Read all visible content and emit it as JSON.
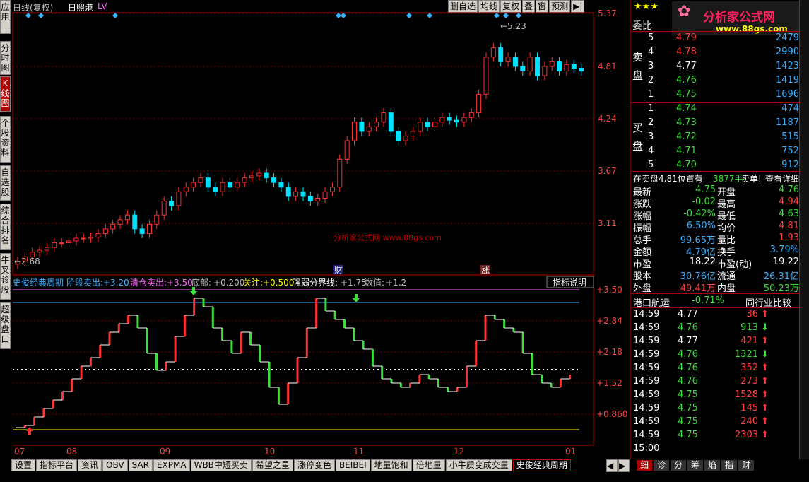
{
  "sidebar": {
    "tabs": [
      {
        "label": "应用"
      },
      {
        "label": "分时图"
      },
      {
        "label": "K线图"
      },
      {
        "label": "个股资料"
      },
      {
        "label": "自选股"
      },
      {
        "label": "综合排名"
      },
      {
        "label": "牛叉诊股"
      },
      {
        "label": "超级盘口"
      }
    ]
  },
  "header": {
    "title": "日线(复权)",
    "stock": "日照港",
    "tag": "LV"
  },
  "toolbar": {
    "buttons": [
      "删自选",
      "均线",
      "复权",
      "叠",
      "窗",
      "预测",
      "▶|"
    ]
  },
  "price_axis": {
    "labels": [
      "5.37",
      "4.81",
      "4.24",
      "3.67",
      "3.11"
    ]
  },
  "annotations": {
    "high": "←5.23",
    "low": "←2.68",
    "event1": "财",
    "event2": "涨",
    "watermark": "分析家公式网 www.88gs.com"
  },
  "indicator": {
    "name": "史俊经典周期",
    "line1": "阶段卖出:",
    "v1": "+3.20",
    "line2": "清仓卖出:",
    "v2": "+3.50",
    "line3": "底部:",
    "v3": "+0.200",
    "line4": "关注:",
    "v4": "+0.500",
    "line5": "强弱分界线:",
    "v5": "+1.75",
    "line6": "数值:",
    "v6": "+1.2",
    "help": "指标说明",
    "axis": [
      "+3.50",
      "+2.84",
      "+2.18",
      "+1.52",
      "+0.860"
    ]
  },
  "xaxis": {
    "labels": [
      "07",
      "08",
      "09",
      "10",
      "11",
      "12",
      "01"
    ]
  },
  "bottom_tabs": [
    "设置",
    "指标平台",
    "资讯",
    "OBV",
    "SAR",
    "EXPMA",
    "WBB中短买卖",
    "希望之星",
    "涨停变色",
    "BEIBEI",
    "地量饱和",
    "倍地量",
    "小牛质变成交量",
    "史俊经典周期"
  ],
  "right": {
    "stars": "★★★",
    "logo": "分析家公式网",
    "site": "www.88gs.com",
    "weibi": "委比",
    "sell_label": "卖盘",
    "buy_label": "买盘",
    "sell": [
      {
        "n": "5",
        "p": "4.79",
        "v": "2479"
      },
      {
        "n": "4",
        "p": "4.78",
        "v": "2990"
      },
      {
        "n": "3",
        "p": "4.77",
        "v": "1423"
      },
      {
        "n": "2",
        "p": "4.76",
        "v": "1419"
      },
      {
        "n": "1",
        "p": "4.75",
        "v": "1696"
      }
    ],
    "buy": [
      {
        "n": "1",
        "p": "4.74",
        "v": "474"
      },
      {
        "n": "2",
        "p": "4.73",
        "v": "1187"
      },
      {
        "n": "3",
        "p": "4.72",
        "v": "515"
      },
      {
        "n": "4",
        "p": "4.71",
        "v": "752"
      },
      {
        "n": "5",
        "p": "4.70",
        "v": "912"
      }
    ],
    "info_line": "在卖盘4.81位置有",
    "info_qty": "3877手",
    "info_action": "卖单!",
    "info_link": "查看详细",
    "stats": [
      {
        "l": "最新",
        "v": "4.75",
        "l2": "开盘",
        "v2": "4.76"
      },
      {
        "l": "涨跌",
        "v": "-0.02",
        "l2": "最高",
        "v2": "4.94"
      },
      {
        "l": "涨幅",
        "v": "-0.42%",
        "l2": "最低",
        "v2": "4.63"
      },
      {
        "l": "振幅",
        "v": "6.50%",
        "l2": "均价",
        "v2": "4.81"
      },
      {
        "l": "总手",
        "v": "99.65万",
        "l2": "量比",
        "v2": "1.93"
      },
      {
        "l": "金额",
        "v": "4.79亿",
        "l2": "换手",
        "v2": "3.79%"
      },
      {
        "l": "市盈",
        "v": "18.22",
        "l2": "市盈(动)",
        "v2": "19.22"
      },
      {
        "l": "股本",
        "v": "30.76亿",
        "l2": "流通",
        "v2": "26.31亿"
      },
      {
        "l": "外盘",
        "v": "49.41万",
        "l2": "内盘",
        "v2": "50.23万"
      }
    ],
    "sector": "港口航运",
    "sector_pct": "-0.71%",
    "compare": "同行业比较",
    "ticks": [
      {
        "t": "14:59",
        "p": "4.77",
        "v": "36",
        "d": "up"
      },
      {
        "t": "14:59",
        "p": "4.76",
        "v": "913",
        "d": "down"
      },
      {
        "t": "14:59",
        "p": "4.77",
        "v": "421",
        "d": "up"
      },
      {
        "t": "14:59",
        "p": "4.76",
        "v": "1321",
        "d": "down"
      },
      {
        "t": "14:59",
        "p": "4.76",
        "v": "352",
        "d": "up"
      },
      {
        "t": "14:59",
        "p": "4.76",
        "v": "273",
        "d": "up"
      },
      {
        "t": "14:59",
        "p": "4.75",
        "v": "1528",
        "d": "up"
      },
      {
        "t": "14:59",
        "p": "4.75",
        "v": "145",
        "d": "up"
      },
      {
        "t": "14:59",
        "p": "4.75",
        "v": "240",
        "d": "up"
      },
      {
        "t": "14:59",
        "p": "4.75",
        "v": "2303",
        "d": "up"
      },
      {
        "t": "15:00",
        "p": "",
        "v": "",
        "d": ""
      }
    ],
    "bottom_tabs": [
      "细",
      "诊",
      "分",
      "筹",
      "焰",
      "指",
      "财"
    ]
  },
  "colors": {
    "up": "#ff3030",
    "down": "#3ddc3d",
    "doji": "#00e0ff",
    "grid": "#800000",
    "axis": "#b00000"
  }
}
